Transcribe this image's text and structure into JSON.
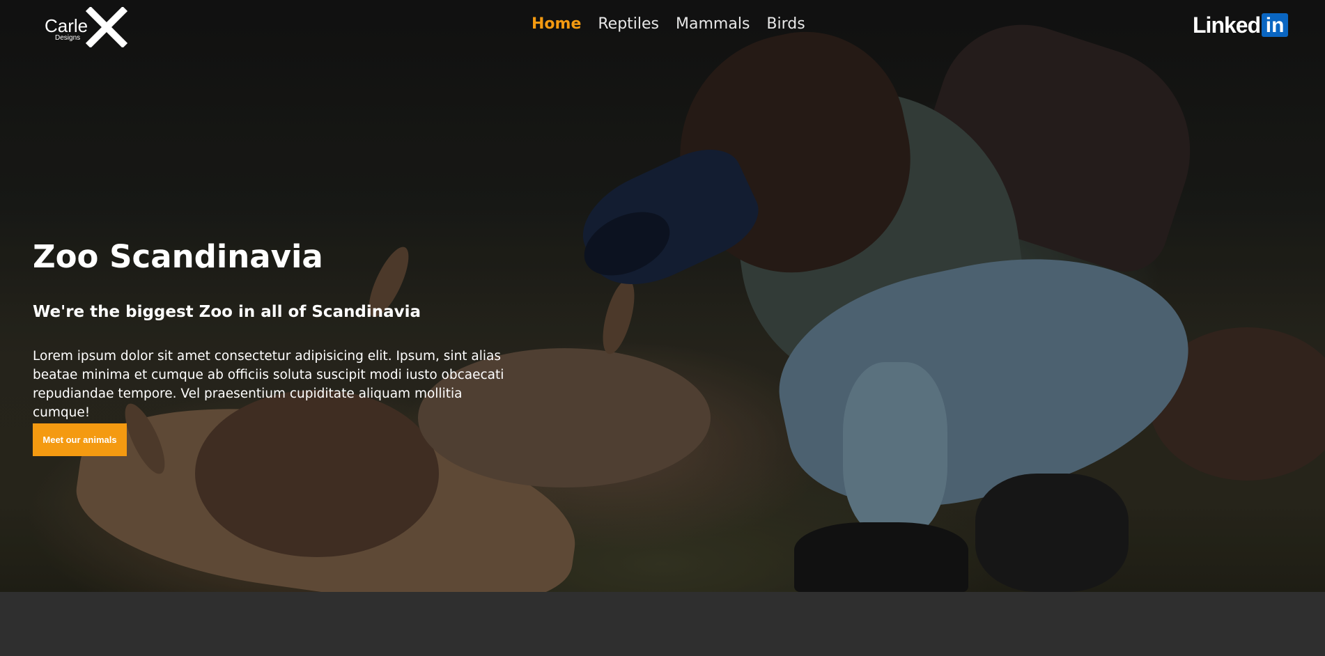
{
  "header": {
    "logo": {
      "text": "Carle",
      "subtext": "Designs"
    },
    "nav": [
      {
        "label": "Home",
        "active": true
      },
      {
        "label": "Reptiles",
        "active": false
      },
      {
        "label": "Mammals",
        "active": false
      },
      {
        "label": "Birds",
        "active": false
      }
    ],
    "social": {
      "linkedin_text": "Linked",
      "linkedin_box": "in"
    }
  },
  "hero": {
    "title": "Zoo Scandinavia",
    "subtitle": "We're the biggest Zoo in all of Scandinavia",
    "text": "Lorem ipsum dolor sit amet consectetur adipisicing elit. Ipsum, sint alias beatae minima et cumque ab officiis soluta suscipit modi iusto obcaecati repudiandae tempore. Vel praesentium cupiditate aliquam mollitia cumque!",
    "cta_label": "Meet our animals"
  },
  "colors": {
    "accent": "#f49a11",
    "linkedin": "#0a66c2",
    "footer_band": "#2f2f2f"
  }
}
